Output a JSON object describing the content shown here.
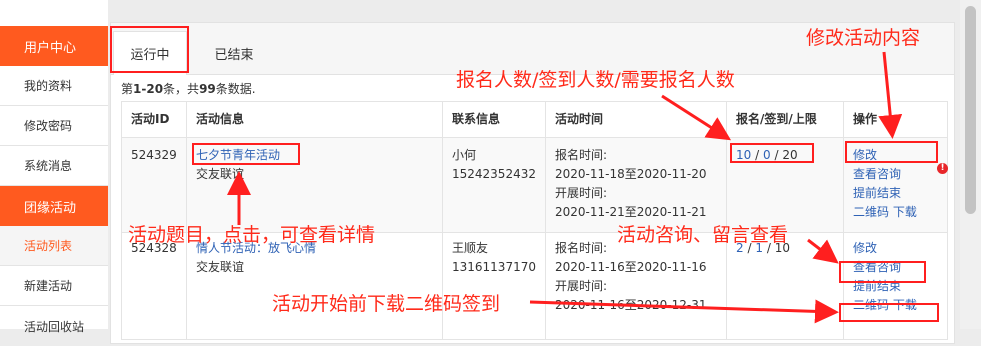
{
  "sidebar": {
    "header": "用户中心",
    "items": [
      "我的资料",
      "修改密码",
      "系统消息"
    ],
    "section": "团缘活动",
    "sub_items": [
      "活动列表",
      "新建活动",
      "活动回收站"
    ]
  },
  "tabs": [
    "运行中",
    "已结束"
  ],
  "summary": {
    "prefix": "第",
    "range": "1-20",
    "mid": "条，共",
    "total": "99",
    "suffix": "条数据."
  },
  "table": {
    "headers": [
      "活动ID",
      "活动信息",
      "联系信息",
      "活动时间",
      "报名/签到/上限",
      "操作"
    ],
    "rows": [
      {
        "id": "524329",
        "title": "七夕节青年活动",
        "org": "交友联谊",
        "contact_name": "小何",
        "contact_phone": "15242352432",
        "signup_label": "报名时间:",
        "signup_range": "2020-11-18至2020-11-20",
        "run_label": "开展时间:",
        "run_range": "2020-11-21至2020-11-21",
        "count_signed": "10",
        "count_checked": "0",
        "count_limit": "20",
        "sep": "/",
        "actions": {
          "edit": "修改",
          "consult": "查看咨询",
          "end": "提前结束",
          "qr": "二维码",
          "download": "下载"
        }
      },
      {
        "id": "524328",
        "title": "情人节活动：放飞心情",
        "org": "交友联谊",
        "contact_name": "王顺友",
        "contact_phone": "13161137170",
        "signup_label": "报名时间:",
        "signup_range": "2020-11-16至2020-11-16",
        "run_label": "开展时间:",
        "run_range": "2020-11-16至2020-12-31",
        "count_signed": "2",
        "count_checked": "1",
        "count_limit": "10",
        "sep": "/",
        "actions": {
          "edit": "修改",
          "consult": "查看咨询",
          "end": "提前结束",
          "qr": "二维码",
          "download": "下载"
        }
      }
    ]
  },
  "annotations": {
    "edit_content": "修改活动内容",
    "counts": "报名人数/签到人数/需要报名人数",
    "title_click": "活动题目，点击，可查看详情",
    "consult": "活动咨询、留言查看",
    "qr": "活动开始前下载二维码签到"
  },
  "colors": {
    "accent": "#ff5a1f",
    "link": "#2f62b5",
    "annotation": "#ff2a1a"
  }
}
